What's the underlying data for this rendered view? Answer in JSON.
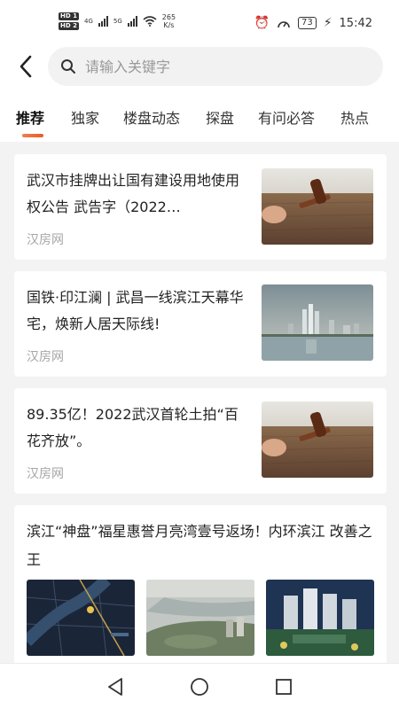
{
  "status_bar": {
    "hd_labels": [
      "HD 1",
      "HD 2"
    ],
    "network_labels": [
      "4G",
      "5G"
    ],
    "speed_value": "265",
    "speed_unit": "K/s",
    "battery": "73",
    "time": "15:42"
  },
  "header": {
    "search_placeholder": "请输入关键字"
  },
  "tabs": [
    {
      "label": "推荐",
      "active": true
    },
    {
      "label": "独家",
      "active": false
    },
    {
      "label": "楼盘动态",
      "active": false
    },
    {
      "label": "探盘",
      "active": false
    },
    {
      "label": "有问必答",
      "active": false
    },
    {
      "label": "热点",
      "active": false
    }
  ],
  "articles": [
    {
      "title": "武汉市挂牌出让国有建设用地使用权公告 武告字（2022…",
      "source": "汉房网",
      "thumbnail": "gavel-on-soil"
    },
    {
      "title": "国铁·印江澜 | 武昌一线滨江天幕华宅，焕新人居天际线!",
      "source": "汉房网",
      "thumbnail": "riverside-skyline"
    },
    {
      "title": "89.35亿！2022武汉首轮土拍“百花齐放”。",
      "source": "汉房网",
      "thumbnail": "gavel-on-soil"
    }
  ],
  "featured_article": {
    "title": "滨江“神盘”福星惠誉月亮湾壹号返场！内环滨江 改善之王",
    "thumbnails": [
      "district-map",
      "riverside-aerial",
      "residential-complex-night"
    ]
  },
  "colors": {
    "accent": "#e85a2a",
    "source_text": "#a6a6a6",
    "background": "#f3f3f3"
  },
  "icons": [
    "back-arrow-icon",
    "search-icon",
    "nav-back-icon",
    "nav-home-icon",
    "nav-recents-icon"
  ]
}
